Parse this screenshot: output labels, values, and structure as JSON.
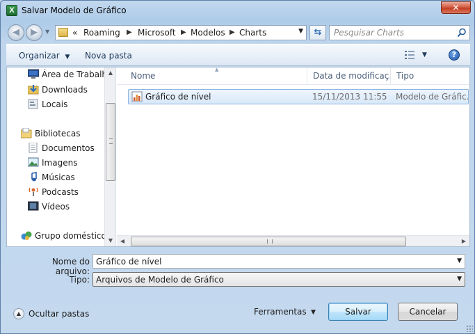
{
  "window": {
    "title": "Salvar Modelo de Gráfico",
    "close_glyph": "✕"
  },
  "address": {
    "overflow": "«",
    "crumbs": [
      "Roaming",
      "Microsoft",
      "Modelos",
      "Charts"
    ]
  },
  "search": {
    "placeholder": "Pesquisar Charts"
  },
  "toolbar": {
    "organize": "Organizar",
    "new_folder": "Nova pasta",
    "help": "?"
  },
  "nav_pane": {
    "items": [
      {
        "label": "Área de Trabalho",
        "icon": "desktop-icon"
      },
      {
        "label": "Downloads",
        "icon": "downloads-icon"
      },
      {
        "label": "Locais",
        "icon": "recent-places-icon"
      },
      {
        "label": "Bibliotecas",
        "icon": "libraries-icon"
      },
      {
        "label": "Documentos",
        "icon": "documents-icon"
      },
      {
        "label": "Imagens",
        "icon": "pictures-icon"
      },
      {
        "label": "Músicas",
        "icon": "music-icon"
      },
      {
        "label": "Podcasts",
        "icon": "podcasts-icon"
      },
      {
        "label": "Vídeos",
        "icon": "videos-icon"
      },
      {
        "label": "Grupo doméstico",
        "icon": "homegroup-icon"
      }
    ]
  },
  "file_list": {
    "columns": [
      "Nome",
      "Data de modificaç...",
      "Tipo"
    ],
    "rows": [
      {
        "name": "Gráfico de nível",
        "date": "15/11/2013 11:55",
        "type": "Modelo de Gráfic..."
      }
    ]
  },
  "form": {
    "filename_label": "Nome do arquivo:",
    "filename_value": "Gráfico de nível",
    "type_label": "Tipo:",
    "type_value": "Arquivos de Modelo de Gráfico"
  },
  "footer": {
    "hide_folders": "Ocultar pastas",
    "tools": "Ferramentas",
    "save": "Salvar",
    "cancel": "Cancelar"
  },
  "colors": {
    "chrome": "#b9d1ea",
    "selection": "#d8e8f8",
    "selection_border": "#8bb4e2",
    "toolbar_text": "#1e395b"
  }
}
